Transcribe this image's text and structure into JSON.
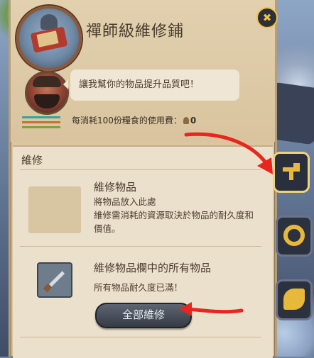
{
  "shop": {
    "title": "禪師級維修鋪",
    "close_label": "✖"
  },
  "npc": {
    "dialog": "讓我幫你的物品提升品質吧！",
    "cost_text": "每消耗100份糧食的使用費：",
    "cost_value": "0",
    "bar_colors": [
      "#2fa7a0",
      "#c8702e",
      "#7aa33a"
    ]
  },
  "repair": {
    "section_title": "維修",
    "slot_title": "維修物品",
    "slot_desc_1": "將物品放入此處",
    "slot_desc_2": "維修需消耗的資源取決於物品的耐久度和價值。",
    "all_title": "維修物品欄中的所有物品",
    "all_desc": "所有物品耐久度已滿！",
    "all_button": "全部維修"
  },
  "side_tabs": [
    {
      "icon": "hammer-icon",
      "active": true
    },
    {
      "icon": "recycle-icon",
      "active": false
    },
    {
      "icon": "horn-icon",
      "active": false
    }
  ],
  "annotations": {
    "color": "#e8261e"
  }
}
